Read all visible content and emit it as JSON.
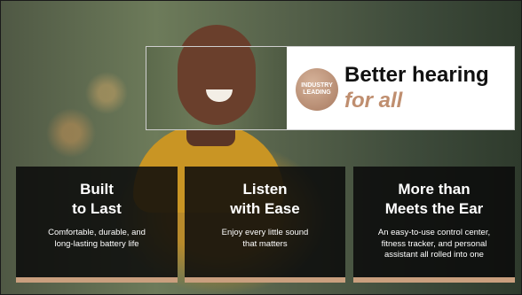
{
  "hero": {
    "badge_line1": "INDUSTRY",
    "badge_line2": "LEADING",
    "title_main": "Better hearing",
    "title_sub": "for all"
  },
  "cards": [
    {
      "title_line1": "Built",
      "title_line2": "to Last",
      "desc_line1": "Comfortable, durable, and",
      "desc_line2": "long-lasting battery life"
    },
    {
      "title_line1": "Listen",
      "title_line2": "with Ease",
      "desc_line1": "Enjoy every little sound",
      "desc_line2": "that matters"
    },
    {
      "title_line1": "More than",
      "title_line2": "Meets the Ear",
      "desc_line1": "An easy-to-use control center,",
      "desc_line2": "fitness tracker, and personal",
      "desc_line3": "assistant all rolled into one"
    }
  ],
  "colors": {
    "accent": "#bf8e6f",
    "card_bar": "#c99f7e",
    "card_bg": "#0a0a0a"
  }
}
